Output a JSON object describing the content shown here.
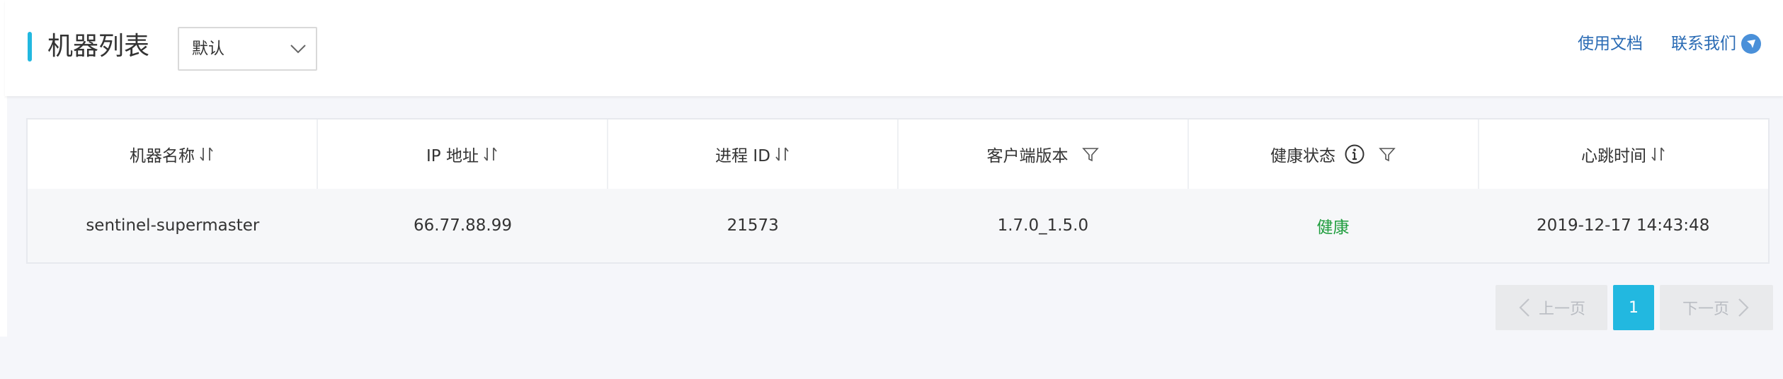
{
  "header": {
    "title": "机器列表",
    "select_value": "默认",
    "links": {
      "docs": "使用文档",
      "contact": "联系我们"
    }
  },
  "table": {
    "columns": [
      "机器名称",
      "IP 地址",
      "进程 ID",
      "客户端版本",
      "健康状态",
      "心跳时间"
    ],
    "rows": [
      [
        "sentinel-supermaster",
        "66.77.88.99",
        "21573",
        "1.7.0_1.5.0",
        "健康",
        "2019-12-17 14:43:48"
      ]
    ]
  },
  "pagination": {
    "prev": "上一页",
    "current": "1",
    "next": "下一页"
  },
  "colors": {
    "accent": "#22b8e0",
    "link": "#2a6bb4",
    "healthy": "#1f9d3e"
  }
}
